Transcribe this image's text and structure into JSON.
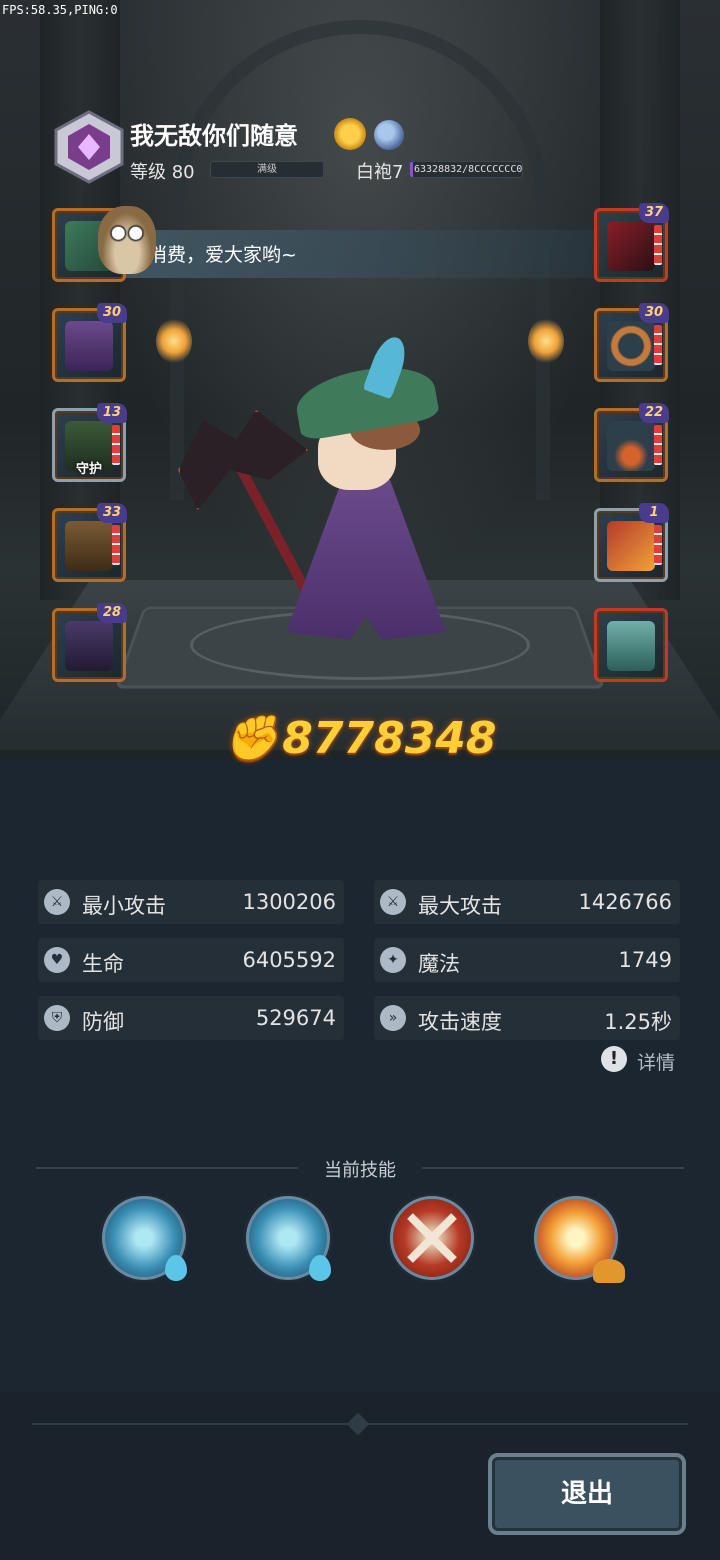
{
  "debug": {
    "fps_text": "FPS:58.35,PING:0"
  },
  "player": {
    "name": "我无敌你们随意",
    "level_label": "等级 80",
    "level_bar_text": "满级",
    "robe_label": "白袍7",
    "robe_progress_text": "63328832/8CCCCCCC0",
    "robe_progress_fraction": 0.03
  },
  "chat": {
    "message": "消费，爱大家哟~"
  },
  "equipment": {
    "left": [
      {
        "level": "",
        "tag": ""
      },
      {
        "level": "30",
        "tag": ""
      },
      {
        "level": "13",
        "tag": "守护"
      },
      {
        "level": "33",
        "tag": ""
      },
      {
        "level": "28",
        "tag": ""
      }
    ],
    "right": [
      {
        "level": "37",
        "tag": ""
      },
      {
        "level": "30",
        "tag": ""
      },
      {
        "level": "22",
        "tag": ""
      },
      {
        "level": "1",
        "tag": ""
      },
      {
        "level": "",
        "tag": ""
      }
    ]
  },
  "power": {
    "value": "8778348",
    "icon": "power-arm-icon"
  },
  "stats": [
    {
      "label": "最小攻击",
      "value": "1300206",
      "icon": "sword-icon"
    },
    {
      "label": "最大攻击",
      "value": "1426766",
      "icon": "sword-icon"
    },
    {
      "label": "生命",
      "value": "6405592",
      "icon": "heart-icon"
    },
    {
      "label": "魔法",
      "value": "1749",
      "icon": "magic-icon"
    },
    {
      "label": "防御",
      "value": "529674",
      "icon": "shield-icon"
    },
    {
      "label": "攻击速度",
      "value": "1.25秒",
      "icon": "speed-icon"
    }
  ],
  "details_label": "详情",
  "skills": {
    "title": "当前技能",
    "items": [
      {
        "icon": "ice-crystal-icon"
      },
      {
        "icon": "ice-spikes-icon"
      },
      {
        "icon": "crossed-axes-icon"
      },
      {
        "icon": "explosion-icon"
      }
    ]
  },
  "exit_label": "退出",
  "colors": {
    "power": "#ffcf3a",
    "panel": "#242f38",
    "background": "#1b2630"
  }
}
